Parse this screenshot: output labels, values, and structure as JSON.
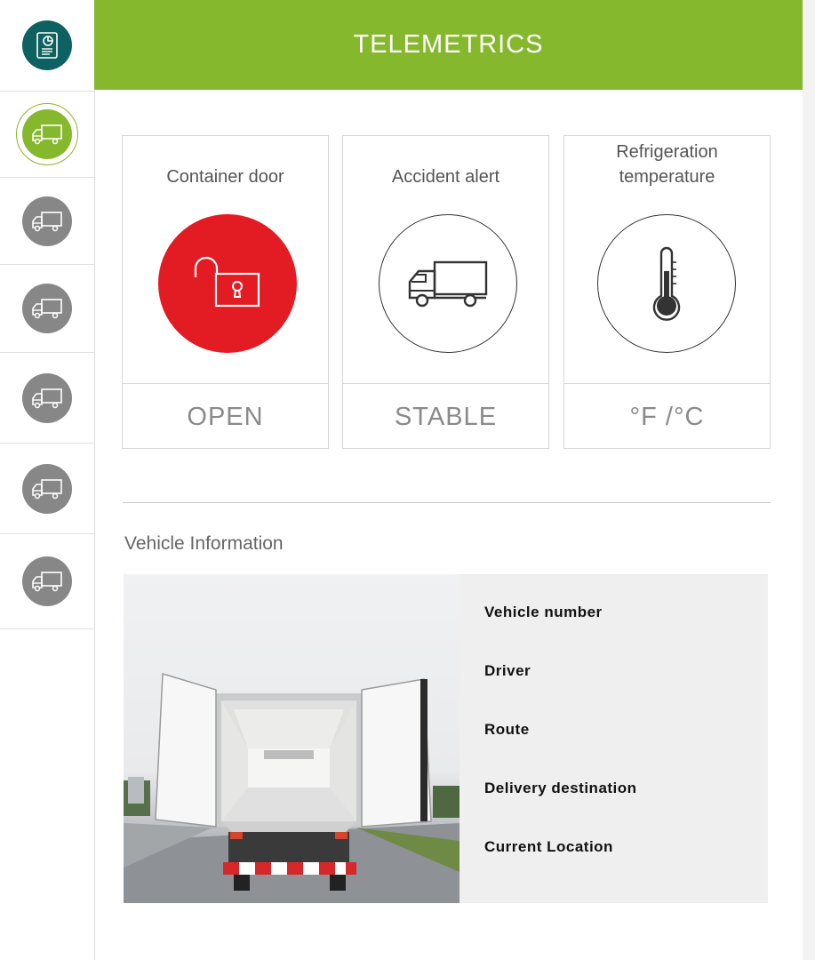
{
  "header": {
    "title": "TELEMETRICS"
  },
  "sidebar": {
    "items": [
      {
        "icon": "report-icon",
        "state": "default"
      },
      {
        "icon": "truck-icon",
        "state": "active"
      },
      {
        "icon": "truck-icon",
        "state": "inactive"
      },
      {
        "icon": "truck-icon",
        "state": "inactive"
      },
      {
        "icon": "truck-icon",
        "state": "inactive"
      },
      {
        "icon": "truck-icon",
        "state": "inactive"
      },
      {
        "icon": "truck-icon",
        "state": "inactive"
      }
    ]
  },
  "cards": [
    {
      "title": "Container door",
      "status": "OPEN",
      "icon": "unlocked-padlock-icon"
    },
    {
      "title": "Accident alert",
      "status": "STABLE",
      "icon": "truck-icon"
    },
    {
      "title": "Refrigeration temperature",
      "status": "°F /°C",
      "icon": "thermometer-icon"
    }
  ],
  "vehicle_info": {
    "section_title": "Vehicle Information",
    "fields": [
      "Vehicle number",
      "Driver",
      "Route",
      "Delivery destination",
      "Current Location"
    ]
  },
  "colors": {
    "brand_green": "#86b82e",
    "teal": "#0d6160",
    "alert_red": "#e31b23",
    "inactive_gray": "#878787"
  }
}
